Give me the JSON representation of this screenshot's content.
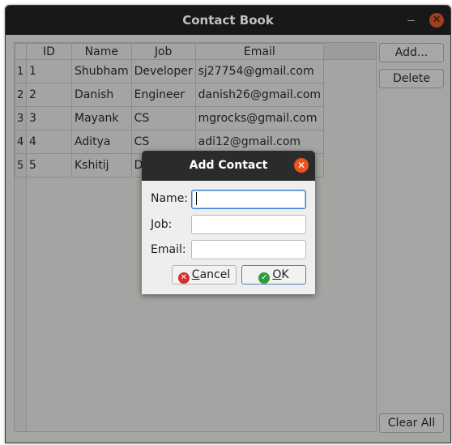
{
  "window": {
    "title": "Contact Book"
  },
  "table": {
    "columns": [
      "ID",
      "Name",
      "Job",
      "Email"
    ],
    "rows": [
      {
        "num": "1",
        "id": "1",
        "name": "Shubham",
        "job": "Developer",
        "email": "sj27754@gmail.com"
      },
      {
        "num": "2",
        "id": "2",
        "name": "Danish",
        "job": "Engineer",
        "email": "danish26@gmail.com"
      },
      {
        "num": "3",
        "id": "3",
        "name": "Mayank",
        "job": "CS",
        "email": "mgrocks@gmail.com"
      },
      {
        "num": "4",
        "id": "4",
        "name": "Aditya",
        "job": "CS",
        "email": "adi12@gmail.com"
      },
      {
        "num": "5",
        "id": "5",
        "name": "Kshitij",
        "job": "Do",
        "email": ""
      }
    ]
  },
  "buttons": {
    "add": "Add...",
    "delete": "Delete",
    "clear_all": "Clear All"
  },
  "dialog": {
    "title": "Add Contact",
    "labels": {
      "name": "Name:",
      "job": "Job:",
      "email": "Email:"
    },
    "values": {
      "name": "",
      "job": "",
      "email": ""
    },
    "cancel": {
      "first": "C",
      "rest": "ancel"
    },
    "ok": {
      "first": "O",
      "rest": "K"
    }
  },
  "colors": {
    "accent_close": "#e95420",
    "focus": "#3a7ad6"
  },
  "icons": {
    "window_close": "close-icon",
    "cancel": "cancel-circle-icon",
    "ok": "check-circle-icon"
  }
}
